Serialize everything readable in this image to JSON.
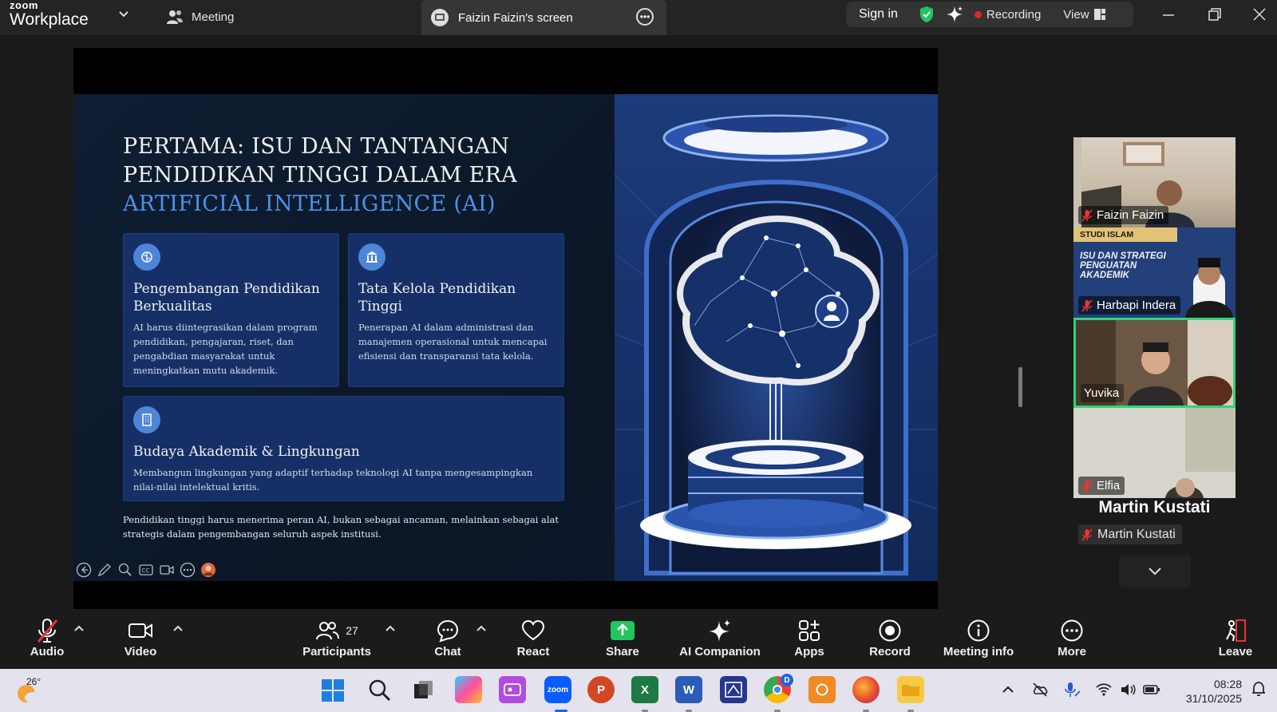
{
  "app": {
    "brand_top": "zoom",
    "brand_bottom": "Workplace",
    "meeting_tab": "Meeting",
    "screen_tab": "Faizin Faizin's screen",
    "sign_in": "Sign in",
    "recording": "Recording",
    "view": "View"
  },
  "slide": {
    "title_line1": "PERTAMA: ISU DAN TANTANGAN",
    "title_line2": "PENDIDIKAN TINGGI DALAM ERA",
    "title_accent": "ARTIFICIAL INTELLIGENCE (AI)",
    "cards": [
      {
        "title": "Pengembangan Pendidikan Berkualitas",
        "body": "AI harus diintegrasikan dalam program pendidikan, pengajaran, riset, dan pengabdian masyarakat untuk meningkatkan mutu akademik.",
        "icon": "brain-icon"
      },
      {
        "title": "Tata Kelola Pendidikan Tinggi",
        "body": "Penerapan AI dalam administrasi dan manajemen operasional untuk mencapai efisiensi dan transparansi tata kelola.",
        "icon": "institution-icon"
      },
      {
        "title": "Budaya Akademik & Lingkungan",
        "body": "Membangun lingkungan yang adaptif terhadap teknologi AI tanpa mengesampingkan nilai-nilai intelektual kritis.",
        "icon": "building-icon"
      }
    ],
    "footer": "Pendidikan tinggi harus menerima peran AI, bukan sebagai ancaman, melainkan sebagai alat strategis dalam pengembangan seluruh aspek institusi."
  },
  "gallery": {
    "tiles": [
      {
        "name": "Faizin Faizin",
        "muted": true
      },
      {
        "name": "Harbapi Indera",
        "muted": true,
        "banner_small": "STUDI ISLAM",
        "banner_big": "ISU DAN STRATEGI PENGUATAN AKADEMIK"
      },
      {
        "name": "Yuvika",
        "muted": false,
        "active": true
      },
      {
        "name": "Elfia",
        "muted": true
      }
    ],
    "speaker_name": "Martin Kustati",
    "speaker_tag": "Martin Kustati"
  },
  "controls": {
    "audio": "Audio",
    "video": "Video",
    "participants": "Participants",
    "participants_count": "27",
    "chat": "Chat",
    "react": "React",
    "share": "Share",
    "ai_companion": "AI Companion",
    "apps": "Apps",
    "record": "Record",
    "meeting_info": "Meeting info",
    "more": "More",
    "leave": "Leave"
  },
  "taskbar": {
    "weather_temp": "26°",
    "time": "08:28",
    "date": "31/10/2025",
    "zoom_label": "zoom",
    "chrome_badge": "D"
  },
  "colors": {
    "accent_blue": "#4d92e8",
    "card_bg": "#163067",
    "active_green": "#2fd37a",
    "share_green": "#22c55e",
    "record_red": "#e02828"
  }
}
